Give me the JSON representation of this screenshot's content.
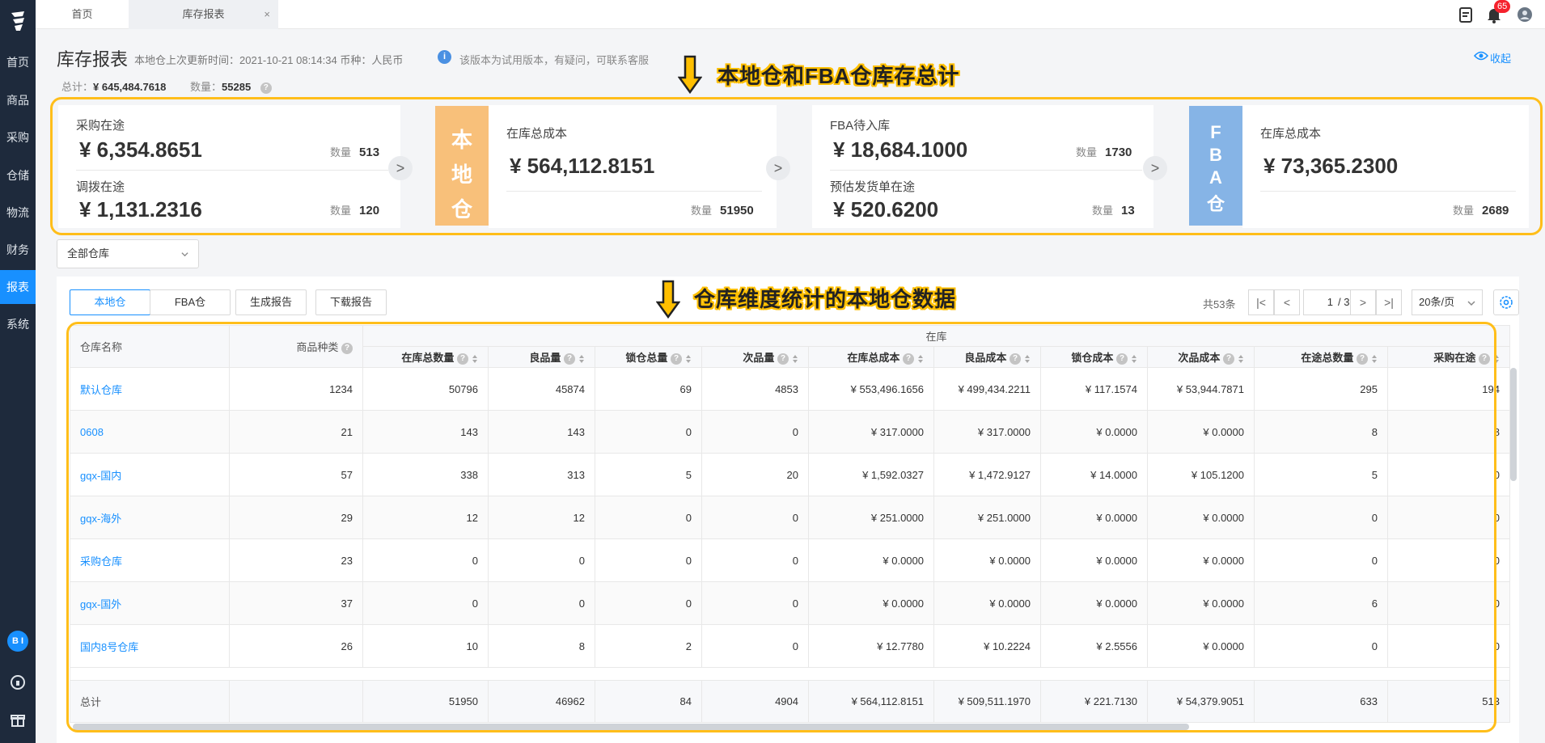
{
  "sidebar": {
    "items": [
      "首页",
      "商品",
      "采购",
      "仓储",
      "物流",
      "财务",
      "报表",
      "系统"
    ],
    "active_index": 6,
    "bi_badge": "B I"
  },
  "topbar": {
    "tabs": [
      "首页",
      "库存报表"
    ],
    "close": "×",
    "notification_count": "65"
  },
  "header": {
    "title": "库存报表",
    "subinfo": "本地仓上次更新时间：2021-10-21 08:14:34 币种：人民币",
    "notice": "该版本为试用版本，有疑问，可联系客服",
    "collapse": "收起",
    "total_label": "总计：",
    "total_value": "¥ 645,484.7618",
    "qty_label": "数量：",
    "qty_value": "55285"
  },
  "annotations": {
    "top": "本地仓和FBA仓库存总计",
    "bottom": "仓库维度统计的本地仓数据"
  },
  "cards": {
    "purchase_label": "采购在途",
    "purchase_value": "¥ 6,354.8651",
    "purchase_qty": "513",
    "transfer_label": "调拨在途",
    "transfer_value": "¥ 1,131.2316",
    "transfer_qty": "120",
    "qty_label": "数量",
    "local_badge": [
      "本",
      "地",
      "仓"
    ],
    "local_cost_label": "在库总成本",
    "local_cost_value": "¥ 564,112.8151",
    "local_cost_qty": "51950",
    "fba_pending_label": "FBA待入库",
    "fba_pending_value": "¥ 18,684.1000",
    "fba_pending_qty": "1730",
    "shipment_label": "预估发货单在途",
    "shipment_value": "¥ 520.6200",
    "shipment_qty": "13",
    "fba_badge": [
      "F",
      "B",
      "A",
      "仓"
    ],
    "fba_cost_label": "在库总成本",
    "fba_cost_value": "¥ 73,365.2300",
    "fba_cost_qty": "2689",
    "chevron": ">"
  },
  "filter": {
    "warehouse_select": "全部仓库"
  },
  "toolbar": {
    "local_tab": "本地仓",
    "fba_tab": "FBA仓",
    "generate": "生成报告",
    "download": "下载报告"
  },
  "pager": {
    "total": "共53条",
    "first": "|<",
    "prev": "<",
    "page": "1",
    "page_total": "/ 3",
    "next": ">",
    "last": ">|",
    "per_page": "20条/页"
  },
  "table": {
    "group_header": "在库",
    "col_name": "仓库名称",
    "col_kinds": "商品种类",
    "columns": [
      "在库总数量",
      "良品量",
      "锁仓总量",
      "次品量",
      "在库总成本",
      "良品成本",
      "锁仓成本",
      "次品成本",
      "在途总数量",
      "采购在途"
    ],
    "rows": [
      [
        "默认仓库",
        "1234",
        "50796",
        "45874",
        "69",
        "4853",
        "¥ 553,496.1656",
        "¥ 499,434.2211",
        "¥ 117.1574",
        "¥ 53,944.7871",
        "295",
        "194"
      ],
      [
        "0608",
        "21",
        "143",
        "143",
        "0",
        "0",
        "¥ 317.0000",
        "¥ 317.0000",
        "¥ 0.0000",
        "¥ 0.0000",
        "8",
        "8"
      ],
      [
        "gqx-国内",
        "57",
        "338",
        "313",
        "5",
        "20",
        "¥ 1,592.0327",
        "¥ 1,472.9127",
        "¥ 14.0000",
        "¥ 105.1200",
        "5",
        "0"
      ],
      [
        "gqx-海外",
        "29",
        "12",
        "12",
        "0",
        "0",
        "¥ 251.0000",
        "¥ 251.0000",
        "¥ 0.0000",
        "¥ 0.0000",
        "0",
        "0"
      ],
      [
        "采购仓库",
        "23",
        "0",
        "0",
        "0",
        "0",
        "¥ 0.0000",
        "¥ 0.0000",
        "¥ 0.0000",
        "¥ 0.0000",
        "0",
        "0"
      ],
      [
        "gqx-国外",
        "37",
        "0",
        "0",
        "0",
        "0",
        "¥ 0.0000",
        "¥ 0.0000",
        "¥ 0.0000",
        "¥ 0.0000",
        "6",
        "0"
      ],
      [
        "国内8号仓库",
        "26",
        "10",
        "8",
        "2",
        "0",
        "¥ 12.7780",
        "¥ 10.2224",
        "¥ 2.5556",
        "¥ 0.0000",
        "0",
        "0"
      ]
    ],
    "summary": [
      "总计",
      "",
      "51950",
      "46962",
      "84",
      "4904",
      "¥ 564,112.8151",
      "¥ 509,511.1970",
      "¥ 221.7130",
      "¥ 54,379.9051",
      "633",
      "513"
    ]
  }
}
